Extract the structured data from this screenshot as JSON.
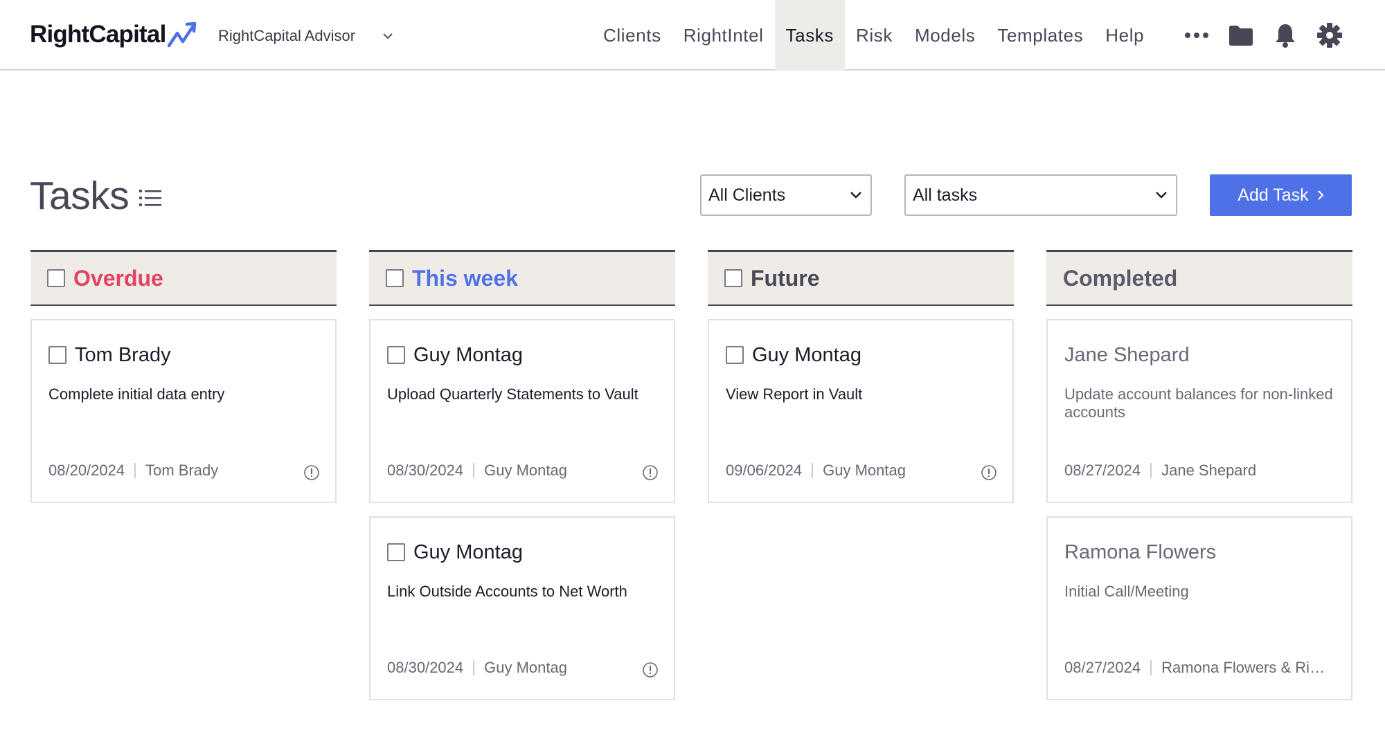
{
  "header": {
    "logo_text": "RightCapital",
    "advisor": "RightCapital Advisor",
    "nav": [
      "Clients",
      "RightIntel",
      "Tasks",
      "Risk",
      "Models",
      "Templates",
      "Help"
    ],
    "active_nav": "Tasks",
    "icons": [
      "more-icon",
      "folder-icon",
      "bell-icon",
      "gear-icon"
    ],
    "accent_color": "#4f71e8"
  },
  "page": {
    "title": "Tasks",
    "client_filter": "All Clients",
    "task_filter": "All tasks",
    "add_task_label": "Add Task"
  },
  "columns": [
    {
      "title": "Overdue",
      "color": "#e4425f",
      "cards": [
        {
          "name": "Tom Brady",
          "desc": "Complete initial data entry",
          "date": "08/20/2024",
          "owner": "Tom Brady"
        }
      ]
    },
    {
      "title": "This week",
      "color": "#4f71e8",
      "cards": [
        {
          "name": "Guy Montag",
          "desc": "Upload Quarterly Statements to Vault",
          "date": "08/30/2024",
          "owner": "Guy Montag"
        },
        {
          "name": "Guy Montag",
          "desc": "Link Outside Accounts to Net Worth",
          "date": "08/30/2024",
          "owner": "Guy Montag"
        }
      ]
    },
    {
      "title": "Future",
      "color": "#4a4656",
      "cards": [
        {
          "name": "Guy Montag",
          "desc": "View Report in Vault",
          "date": "09/06/2024",
          "owner": "Guy Montag"
        }
      ]
    },
    {
      "title": "Completed",
      "color": "#5d5968",
      "cards": [
        {
          "name": "Jane Shepard",
          "desc": "Update account balances for non-linked accounts",
          "date": "08/27/2024",
          "owner": "Jane Shepard"
        },
        {
          "name": "Ramona Flowers",
          "desc": "Initial Call/Meeting",
          "date": "08/27/2024",
          "owner": "Ramona Flowers & Righ..."
        }
      ]
    }
  ]
}
